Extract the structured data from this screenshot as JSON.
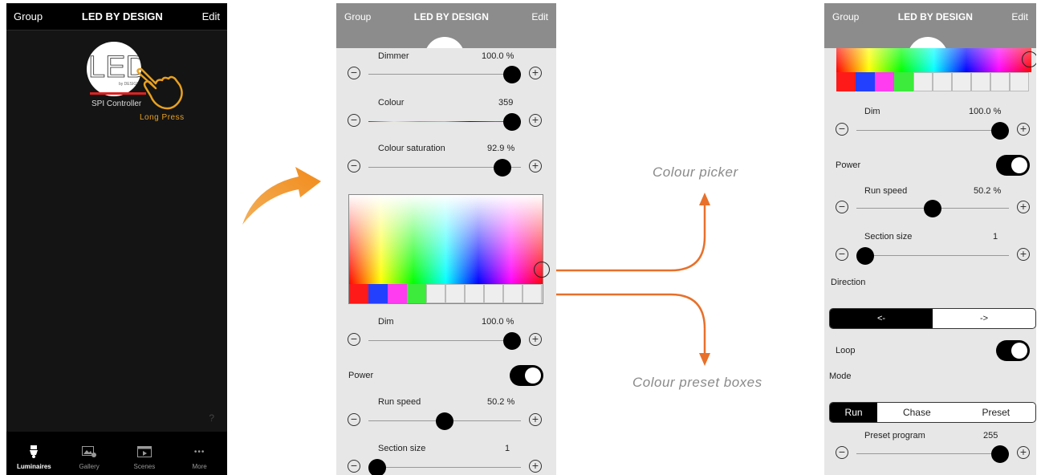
{
  "phone1": {
    "nav": {
      "left": "Group",
      "title": "LED BY DESIGN",
      "right": "Edit"
    },
    "device_label": "SPI Controller",
    "gesture_label": "Long Press",
    "help": "?",
    "tabs": [
      {
        "label": "Luminaires",
        "icon": "spotlight-icon"
      },
      {
        "label": "Gallery",
        "icon": "gallery-icon"
      },
      {
        "label": "Scenes",
        "icon": "scenes-icon"
      },
      {
        "label": "More",
        "icon": "more-icon"
      }
    ],
    "more_glyph": "•••"
  },
  "phone2": {
    "nav": {
      "left": "Group",
      "title": "LED BY DESIGN",
      "right": "Edit"
    },
    "dimmer": {
      "label": "Dimmer",
      "value": "100.0 %",
      "level": 1.0
    },
    "colour": {
      "label": "Colour",
      "value": "359",
      "level": 1.0
    },
    "saturation": {
      "label": "Colour saturation",
      "value": "92.9 %",
      "level": 0.929
    },
    "dim": {
      "label": "Dim",
      "value": "100.0 %",
      "level": 1.0
    },
    "power": {
      "label": "Power",
      "on": true
    },
    "run_speed": {
      "label": "Run speed",
      "value": "50.2 %",
      "level": 0.502
    },
    "section_size": {
      "label": "Section size",
      "value": "1",
      "level": 0.0
    },
    "presets": [
      "#ff1a1a",
      "#2440ff",
      "#ff3cf0",
      "#3ceb3c",
      "",
      "",
      "",
      "",
      "",
      ""
    ]
  },
  "phone3": {
    "nav": {
      "left": "Group",
      "title": "LED BY DESIGN",
      "right": "Edit"
    },
    "presets": [
      "#ff1a1a",
      "#2440ff",
      "#ff3cf0",
      "#3ceb3c",
      "",
      "",
      "",
      "",
      "",
      ""
    ],
    "dim": {
      "label": "Dim",
      "value": "100.0 %",
      "level": 1.0
    },
    "power": {
      "label": "Power",
      "on": true
    },
    "run_speed": {
      "label": "Run speed",
      "value": "50.2 %",
      "level": 0.502
    },
    "section_size": {
      "label": "Section size",
      "value": "1",
      "level": 0.0
    },
    "direction": {
      "label": "Direction",
      "options": [
        "<-",
        "->"
      ],
      "selected": 0
    },
    "loop": {
      "label": "Loop",
      "on": true
    },
    "mode": {
      "label": "Mode",
      "options": [
        "Run",
        "Chase",
        "Preset"
      ],
      "selected": 0
    },
    "preset_program": {
      "label": "Preset program",
      "value": "255",
      "level": 1.0
    }
  },
  "annotations": {
    "picker": "Colour picker",
    "presets": "Colour preset boxes"
  },
  "colors": {
    "accent_orange": "#e8702a",
    "nav_gray": "#8c8c8c",
    "panel_bg": "#e7e7e7"
  }
}
